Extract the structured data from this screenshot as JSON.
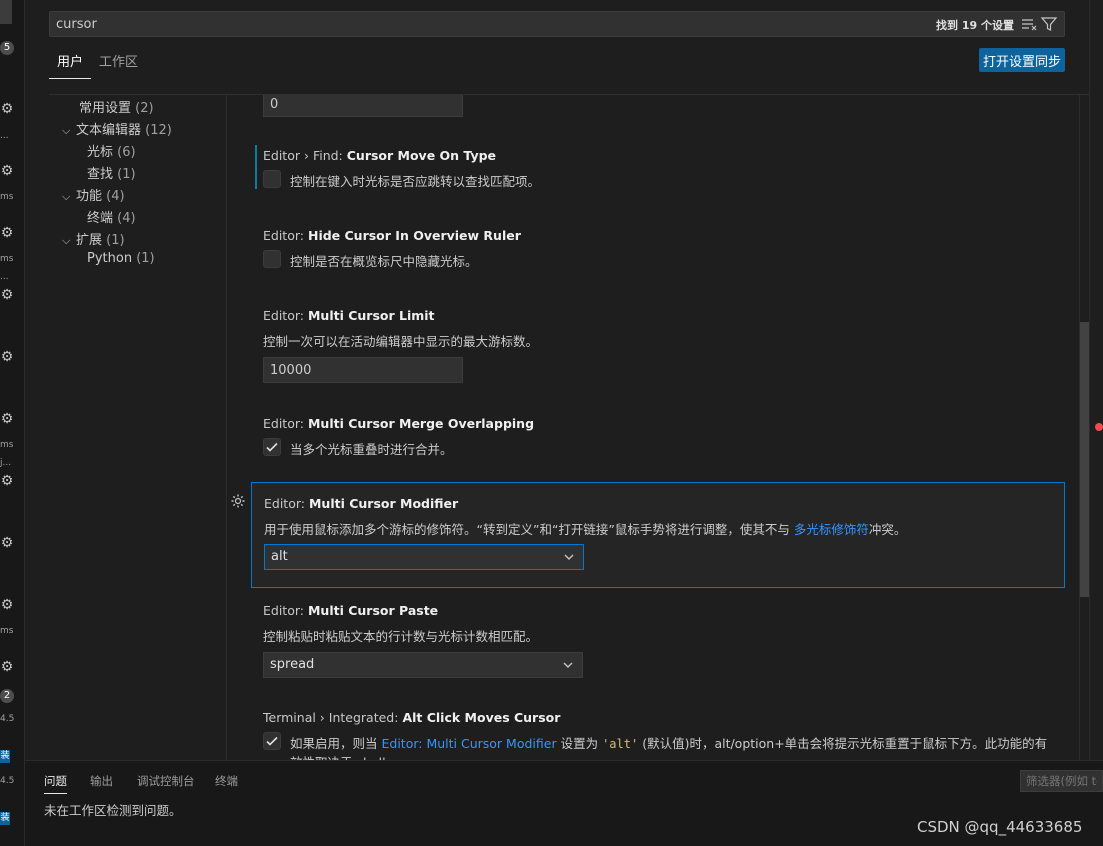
{
  "search": {
    "value": "cursor",
    "results": "找到 19 个设置"
  },
  "tabs": {
    "user": "用户",
    "workspace": "工作区"
  },
  "sync_button": "打开设置同步",
  "toc": [
    {
      "label": "常用设置",
      "count": "(2)"
    },
    {
      "label": "文本编辑器",
      "count": "(12)"
    },
    {
      "label": "光标",
      "count": "(6)"
    },
    {
      "label": "查找",
      "count": "(1)"
    },
    {
      "label": "功能",
      "count": "(4)"
    },
    {
      "label": "终端",
      "count": "(4)"
    },
    {
      "label": "扩展",
      "count": "(1)"
    },
    {
      "label": "Python",
      "count": "(1)"
    }
  ],
  "settings": {
    "top_input": {
      "value": "0"
    },
    "find_cursor_move": {
      "category": "Editor › Find:",
      "name": "Cursor Move On Type",
      "desc": "控制在键入时光标是否应跳转以查找匹配项。",
      "checked": false
    },
    "hide_cursor": {
      "category": "Editor:",
      "name": "Hide Cursor In Overview Ruler",
      "desc": "控制是否在概览标尺中隐藏光标。",
      "checked": false
    },
    "multi_limit": {
      "category": "Editor:",
      "name": "Multi Cursor Limit",
      "desc": "控制一次可以在活动编辑器中显示的最大游标数。",
      "value": "10000"
    },
    "multi_merge": {
      "category": "Editor:",
      "name": "Multi Cursor Merge Overlapping",
      "desc": "当多个光标重叠时进行合并。",
      "checked": true
    },
    "multi_modifier": {
      "category": "Editor:",
      "name": "Multi Cursor Modifier",
      "desc_pre": "用于使用鼠标添加多个游标的修饰符。“转到定义”和“打开链接”鼠标手势将进行调整，使其不与",
      "desc_link": "多光标修饰符",
      "desc_post": "冲突。",
      "value": "alt"
    },
    "multi_paste": {
      "category": "Editor:",
      "name": "Multi Cursor Paste",
      "desc": "控制粘贴时粘贴文本的行计数与光标计数相匹配。",
      "value": "spread"
    },
    "alt_click": {
      "category": "Terminal › Integrated:",
      "name": "Alt Click Moves Cursor",
      "desc_pre": "如果启用，则当",
      "desc_link": "Editor: Multi Cursor Modifier",
      "desc_mid": "设置为",
      "desc_code": "'alt'",
      "desc_post": "(默认值)时，alt/option+单击会将提示光标重置于鼠标下方。此功能的有",
      "desc_line2": "效性取决于 shell",
      "checked": true
    }
  },
  "panel": {
    "tabs": [
      "问题",
      "输出",
      "调试控制台",
      "终端"
    ],
    "message": "未在工作区检测到问题。",
    "filter_placeholder": "筛选器(例如 te"
  },
  "watermark": "CSDN @qq_44633685",
  "sliver": {
    "badge1": "5",
    "badge2": "2",
    "blue": "装",
    "ms": "ms",
    "dots": "...",
    "ver": "4.5",
    "j": "j..."
  },
  "colors": {
    "accent": "#0078d4",
    "button": "#0e639c",
    "link": "#3794ff",
    "error_dot": "#f14c4c"
  }
}
